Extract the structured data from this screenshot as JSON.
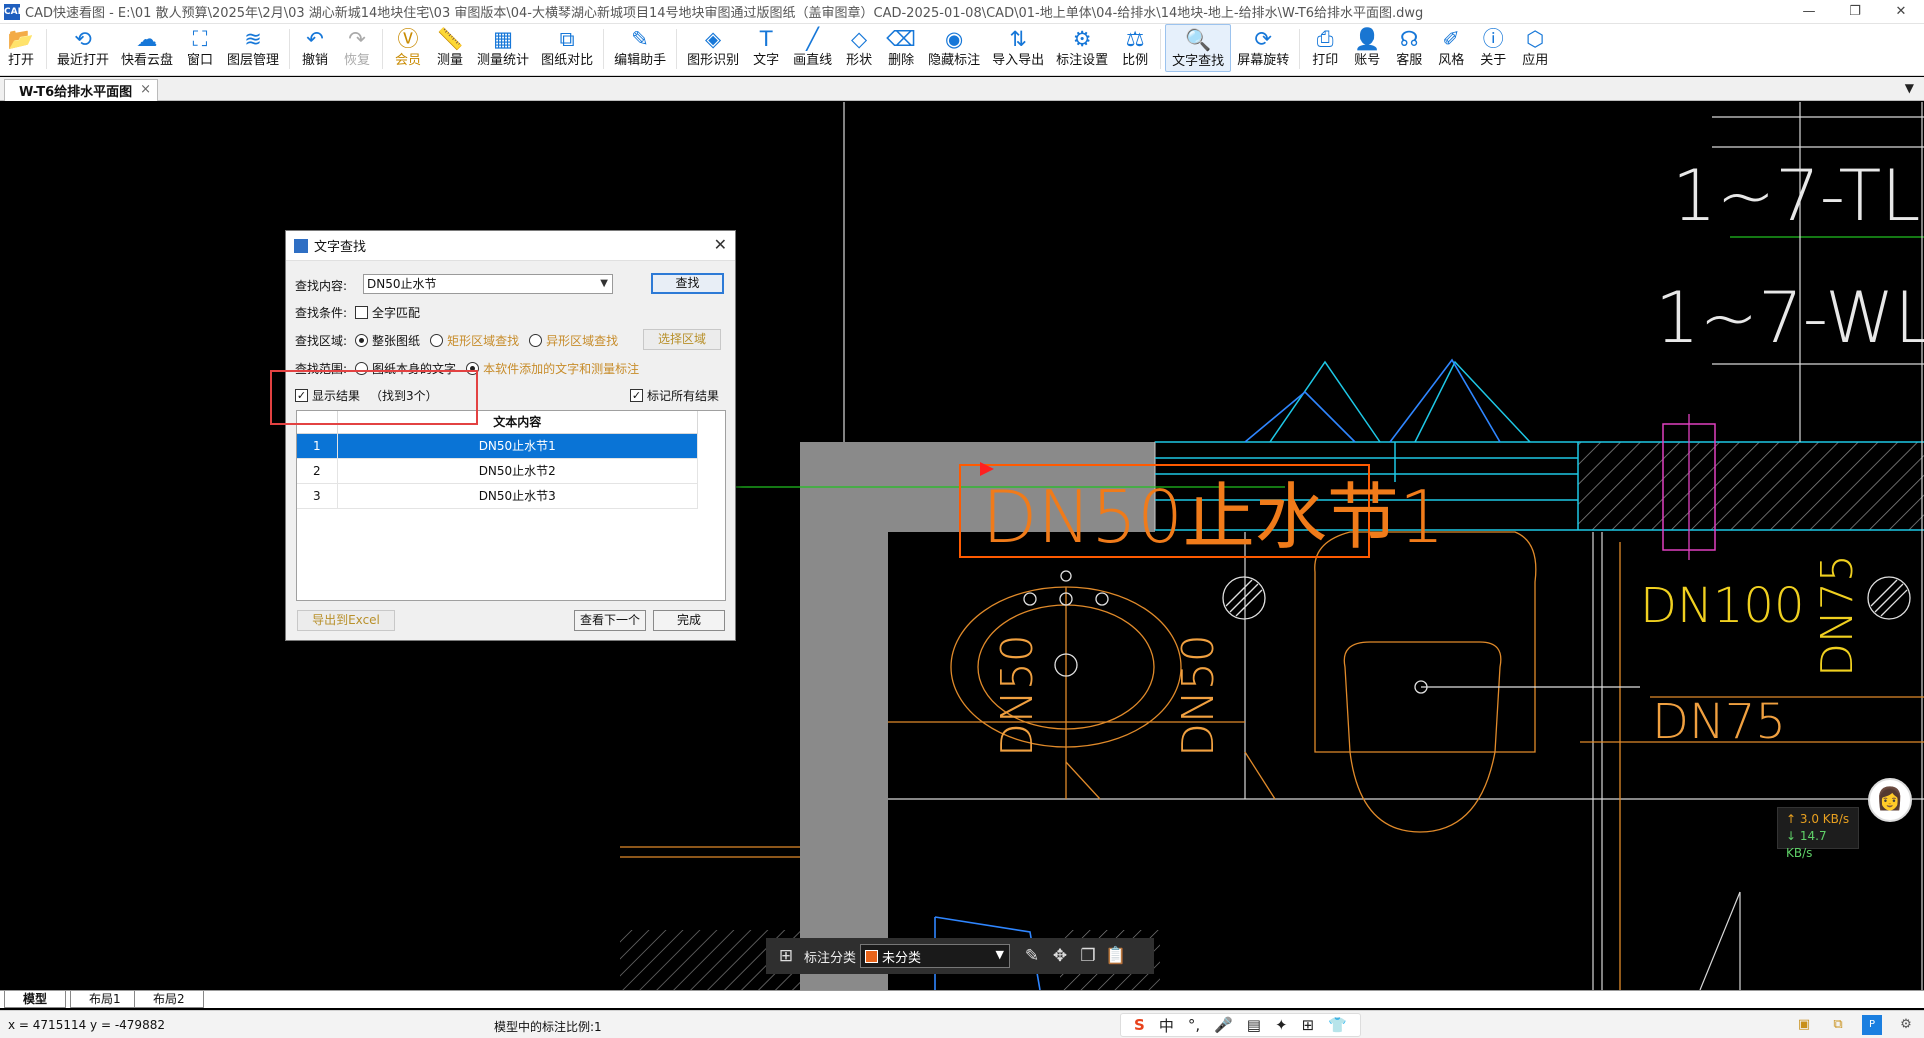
{
  "window": {
    "title": "CAD快速看图 - E:\\01 散人预算\\2025年\\2月\\03 湖心新城14地块住宅\\03 审图版本\\04-大横琴湖心新城项目14号地块审图通过版图纸（盖审图章）CAD-2025-01-08\\CAD\\01-地上单体\\04-给排水\\14地块-地上-给排水\\W-T6给排水平面图.dwg",
    "controls": {
      "minimize": "—",
      "restore": "❐",
      "close": "✕"
    }
  },
  "toolbar": [
    {
      "label": "打开",
      "icon": "folder-open-icon",
      "glyph": "📂"
    },
    {
      "label": "最近打开",
      "icon": "history-icon",
      "glyph": "⟲"
    },
    {
      "label": "快看云盘",
      "icon": "cloud-icon",
      "glyph": "☁"
    },
    {
      "label": "窗口",
      "icon": "window-icon",
      "glyph": "⛶"
    },
    {
      "label": "图层管理",
      "icon": "layers-icon",
      "glyph": "≋"
    },
    {
      "label": "撤销",
      "icon": "undo-icon",
      "glyph": "↶"
    },
    {
      "label": "恢复",
      "icon": "redo-icon",
      "glyph": "↷",
      "disabled": true
    },
    {
      "label": "会员",
      "icon": "vip-icon",
      "glyph": "Ⓥ",
      "vip": true
    },
    {
      "label": "测量",
      "icon": "ruler-icon",
      "glyph": "📏"
    },
    {
      "label": "测量统计",
      "icon": "measure-stats-icon",
      "glyph": "▦"
    },
    {
      "label": "图纸对比",
      "icon": "compare-icon",
      "glyph": "⧉"
    },
    {
      "label": "编辑助手",
      "icon": "edit-assistant-icon",
      "glyph": "✎"
    },
    {
      "label": "图形识别",
      "icon": "shape-recognition-icon",
      "glyph": "◈"
    },
    {
      "label": "文字",
      "icon": "text-icon",
      "glyph": "T"
    },
    {
      "label": "画直线",
      "icon": "line-icon",
      "glyph": "╱"
    },
    {
      "label": "形状",
      "icon": "shape-icon",
      "glyph": "◇"
    },
    {
      "label": "删除",
      "icon": "eraser-icon",
      "glyph": "⌫"
    },
    {
      "label": "隐藏标注",
      "icon": "hide-annotation-icon",
      "glyph": "◉"
    },
    {
      "label": "导入导出",
      "icon": "import-export-icon",
      "glyph": "⇅"
    },
    {
      "label": "标注设置",
      "icon": "annotation-settings-icon",
      "glyph": "⚙"
    },
    {
      "label": "比例",
      "icon": "scale-icon",
      "glyph": "⚖"
    },
    {
      "label": "文字查找",
      "icon": "text-search-icon",
      "glyph": "🔍",
      "active": true
    },
    {
      "label": "屏幕旋转",
      "icon": "rotate-screen-icon",
      "glyph": "⟳"
    },
    {
      "label": "打印",
      "icon": "print-icon",
      "glyph": "⎙"
    },
    {
      "label": "账号",
      "icon": "account-icon",
      "glyph": "👤"
    },
    {
      "label": "客服",
      "icon": "support-icon",
      "glyph": "☊"
    },
    {
      "label": "风格",
      "icon": "style-icon",
      "glyph": "✐"
    },
    {
      "label": "关于",
      "icon": "about-icon",
      "glyph": "ⓘ"
    },
    {
      "label": "应用",
      "icon": "apps-icon",
      "glyph": "⬡"
    }
  ],
  "doc_tab": {
    "label": "W-T6给排水平面图",
    "close": "×",
    "overflow": "▼"
  },
  "drawing": {
    "texts": [
      "1~7-TL",
      "1~7-WL",
      "DN50止水节1",
      "DN100",
      "DN75",
      "DN75",
      "DN50",
      "DN50"
    ]
  },
  "dialog": {
    "title": "文字查找",
    "close": "✕",
    "search_label": "查找内容:",
    "search_value": "DN50止水节",
    "search_button": "查找",
    "condition_label": "查找条件:",
    "whole_word": "全字匹配",
    "area_label": "查找区域:",
    "area_options": [
      "整张图纸",
      "矩形区域查找",
      "异形区域查找"
    ],
    "select_area_button": "选择区域",
    "scope_label": "查找范围:",
    "scope_options": [
      "图纸本身的文字",
      "本软件添加的文字和测量标注"
    ],
    "show_results": "显示结果",
    "found_count": "（找到3个）",
    "mark_all": "标记所有结果",
    "table_header": "文本内容",
    "results": [
      {
        "index": "1",
        "text": "DN50止水节1"
      },
      {
        "index": "2",
        "text": "DN50止水节2"
      },
      {
        "index": "3",
        "text": "DN50止水节3"
      }
    ],
    "export_button": "导出到Excel",
    "next_button": "查看下一个",
    "done_button": "完成"
  },
  "annotation_bar": {
    "label": "标注分类",
    "category": "未分类",
    "category_color": "#e8641b"
  },
  "speed": {
    "up": "↑ 3.0 KB/s",
    "down": "↓ 14.7 KB/s"
  },
  "layout_tabs": [
    "模型",
    "布局1",
    "布局2"
  ],
  "status": {
    "coords": "x = 4715114  y = -479882",
    "scale": "模型中的标注比例:1"
  },
  "ime": [
    "S",
    "中",
    "°,",
    "🎤",
    "▤",
    "✦",
    "⊞",
    "👕"
  ]
}
